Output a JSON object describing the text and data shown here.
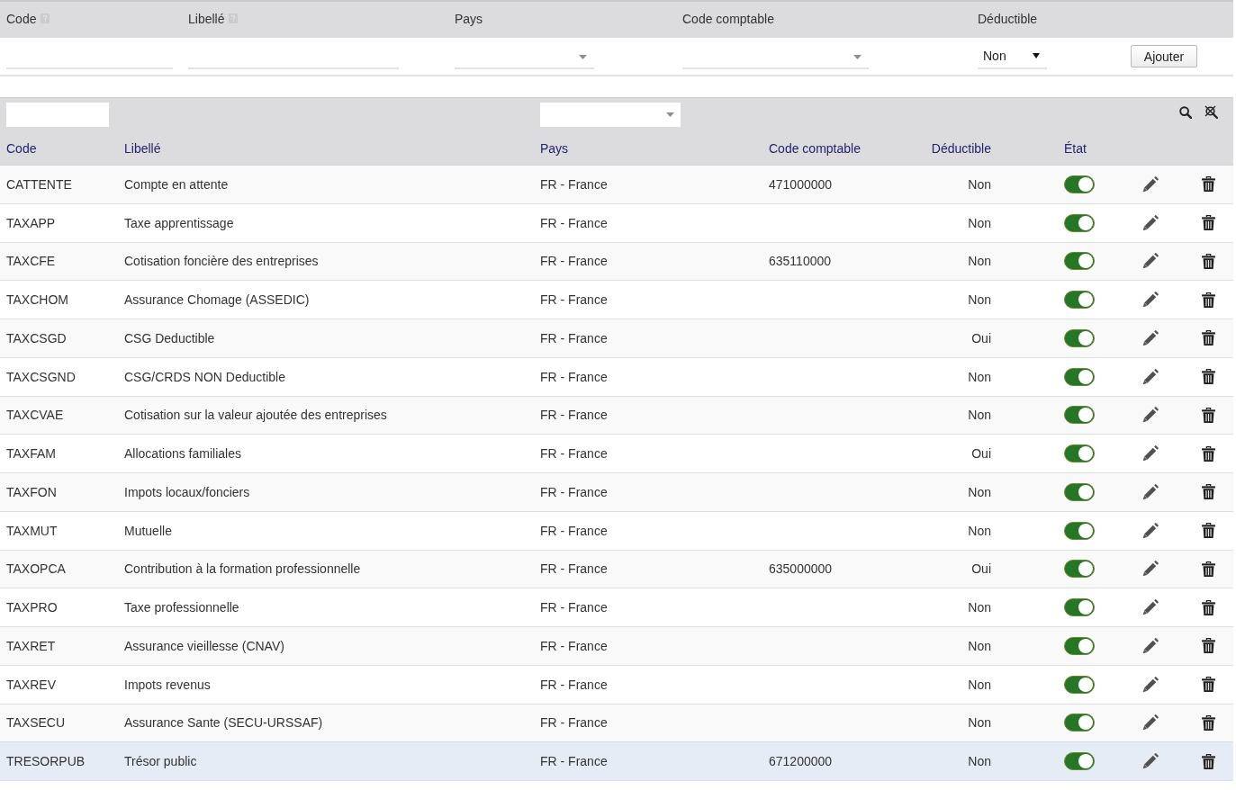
{
  "form": {
    "fields": [
      {
        "label": "Code",
        "help": true,
        "kind": "text"
      },
      {
        "label": "Libellé",
        "help": true,
        "kind": "text"
      },
      {
        "label": "Pays",
        "help": false,
        "kind": "select"
      },
      {
        "label": "Code comptable",
        "help": false,
        "kind": "select"
      },
      {
        "label": "Déductible",
        "help": false,
        "kind": "dropdown",
        "value": "Non"
      }
    ],
    "button": "Ajouter"
  },
  "table": {
    "columns": [
      {
        "label": "Code",
        "filter": {
          "kind": "text"
        }
      },
      {
        "label": "Libellé"
      },
      {
        "label": "Pays",
        "filter": {
          "kind": "select"
        }
      },
      {
        "label": "Code comptable"
      },
      {
        "label": "Déductible"
      },
      {
        "label": "État"
      }
    ],
    "rows": [
      {
        "code": "CATTENTE",
        "label": "Compte en attente",
        "country": "FR - France",
        "accounting_code": "471000000",
        "deductible": "Non",
        "active": true,
        "selected": false
      },
      {
        "code": "TAXAPP",
        "label": "Taxe apprentissage",
        "country": "FR - France",
        "deductible": "Non",
        "active": true,
        "selected": false
      },
      {
        "code": "TAXCFE",
        "label": "Cotisation foncière des entreprises",
        "country": "FR - France",
        "accounting_code": "635110000",
        "deductible": "Non",
        "active": true,
        "selected": false
      },
      {
        "code": "TAXCHOM",
        "label": "Assurance Chomage (ASSEDIC)",
        "country": "FR - France",
        "deductible": "Non",
        "active": true,
        "selected": false
      },
      {
        "code": "TAXCSGD",
        "label": "CSG Deductible",
        "country": "FR - France",
        "deductible": "Oui",
        "active": true,
        "selected": false
      },
      {
        "code": "TAXCSGND",
        "label": "CSG/CRDS NON Deductible",
        "country": "FR - France",
        "deductible": "Non",
        "active": true,
        "selected": false
      },
      {
        "code": "TAXCVAE",
        "label": "Cotisation sur la valeur ajoutée des entreprises",
        "country": "FR - France",
        "deductible": "Non",
        "active": true,
        "selected": false
      },
      {
        "code": "TAXFAM",
        "label": "Allocations familiales",
        "country": "FR - France",
        "deductible": "Oui",
        "active": true,
        "selected": false
      },
      {
        "code": "TAXFON",
        "label": "Impots locaux/fonciers",
        "country": "FR - France",
        "deductible": "Non",
        "active": true,
        "selected": false
      },
      {
        "code": "TAXMUT",
        "label": "Mutuelle",
        "country": "FR - France",
        "deductible": "Non",
        "active": true,
        "selected": false
      },
      {
        "code": "TAXOPCA",
        "label": "Contribution à la formation professionnelle",
        "country": "FR - France",
        "accounting_code": "635000000",
        "deductible": "Oui",
        "active": true,
        "selected": false
      },
      {
        "code": "TAXPRO",
        "label": "Taxe professionnelle",
        "country": "FR - France",
        "deductible": "Non",
        "active": true,
        "selected": false
      },
      {
        "code": "TAXRET",
        "label": "Assurance vieillesse (CNAV)",
        "country": "FR - France",
        "deductible": "Non",
        "active": true,
        "selected": false
      },
      {
        "code": "TAXREV",
        "label": "Impots revenus",
        "country": "FR - France",
        "deductible": "Non",
        "active": true,
        "selected": false
      },
      {
        "code": "TAXSECU",
        "label": "Assurance Sante (SECU-URSSAF)",
        "country": "FR - France",
        "deductible": "Non",
        "active": true,
        "selected": false
      },
      {
        "code": "TRESORPUB",
        "label": "Trésor public",
        "country": "FR - France",
        "accounting_code": "671200000",
        "deductible": "Non",
        "active": true,
        "selected": true
      }
    ]
  }
}
